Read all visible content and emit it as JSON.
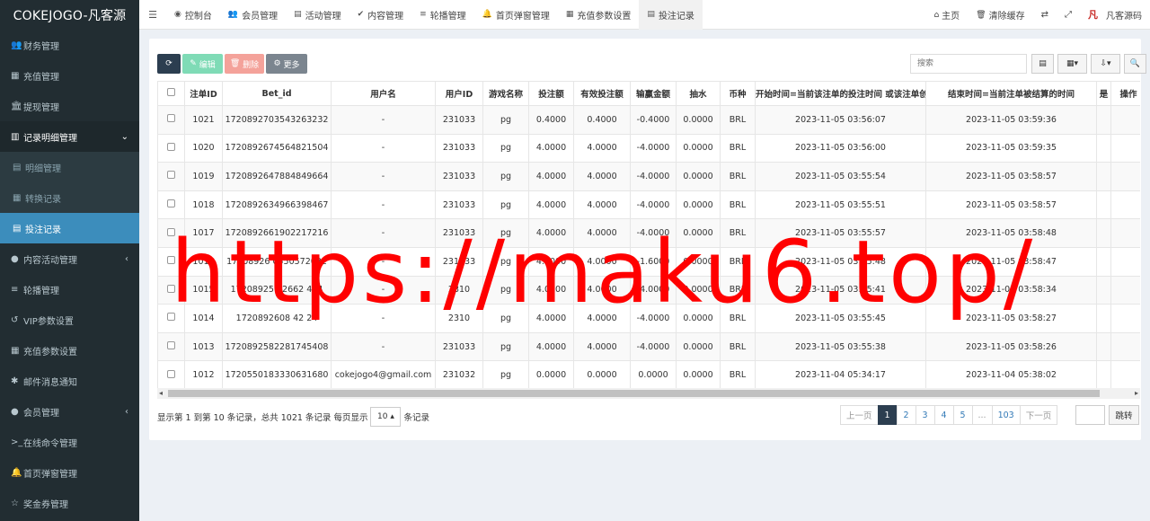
{
  "app": {
    "title": "COKEJOGO-凡客源"
  },
  "sidebar": {
    "items": [
      {
        "icon": "users-icon",
        "glyph": "👥",
        "label": "财务管理"
      },
      {
        "icon": "grid-icon",
        "glyph": "▦",
        "label": "充值管理"
      },
      {
        "icon": "bank-icon",
        "glyph": "🏛",
        "label": "提现管理"
      },
      {
        "icon": "bar-chart-icon",
        "glyph": "▥",
        "label": "记录明细管理"
      },
      {
        "icon": "calendar-icon",
        "glyph": "▤",
        "label": "明细管理"
      },
      {
        "icon": "grid-icon",
        "glyph": "▦",
        "label": "转换记录"
      },
      {
        "icon": "calendar-icon",
        "glyph": "▤",
        "label": "投注记录"
      },
      {
        "icon": "chat-icon",
        "glyph": "●",
        "label": "内容活动管理"
      },
      {
        "icon": "bars-icon",
        "glyph": "≡",
        "label": "轮播管理"
      },
      {
        "icon": "history-icon",
        "glyph": "↺",
        "label": "VIP参数设置"
      },
      {
        "icon": "grid-icon",
        "glyph": "▦",
        "label": "充值参数设置"
      },
      {
        "icon": "asterisk-icon",
        "glyph": "✱",
        "label": "邮件消息通知"
      },
      {
        "icon": "user-circle-icon",
        "glyph": "●",
        "label": "会员管理"
      },
      {
        "icon": "terminal-icon",
        "glyph": ">_",
        "label": "在线命令管理"
      },
      {
        "icon": "bell-icon",
        "glyph": "🔔",
        "label": "首页弹窗管理"
      },
      {
        "icon": "star-icon",
        "glyph": "☆",
        "label": "奖金券管理"
      }
    ]
  },
  "topnav": {
    "tabs": [
      {
        "icon": "dashboard-icon",
        "glyph": "◉",
        "label": "控制台"
      },
      {
        "icon": "users-icon",
        "glyph": "👥",
        "label": "会员管理"
      },
      {
        "icon": "calendar-icon",
        "glyph": "▤",
        "label": "活动管理"
      },
      {
        "icon": "check-circle-icon",
        "glyph": "✔",
        "label": "内容管理"
      },
      {
        "icon": "bars-icon",
        "glyph": "≡",
        "label": "轮播管理"
      },
      {
        "icon": "bell-icon",
        "glyph": "🔔",
        "label": "首页弹窗管理"
      },
      {
        "icon": "grid-icon",
        "glyph": "▦",
        "label": "充值参数设置"
      },
      {
        "icon": "calendar-icon",
        "glyph": "▤",
        "label": "投注记录"
      }
    ],
    "right": {
      "home": "主页",
      "clear_cache": "清除缓存",
      "brand": "凡客源码"
    }
  },
  "toolbar": {
    "edit_label": "编辑",
    "delete_label": "删除",
    "more_label": "更多",
    "search_placeholder": "搜索"
  },
  "table": {
    "columns": [
      "注单ID",
      "Bet_id",
      "用户名",
      "用户ID",
      "游戏名称",
      "投注额",
      "有效投注额",
      "输赢金额",
      "抽水",
      "币种",
      "开始时间=当前该注单的投注时间 或该注单创建时间",
      "结束时间=当前注单被结算的时间",
      "是",
      "操作"
    ],
    "rows": [
      [
        "1021",
        "1720892703543263232",
        "-",
        "231033",
        "pg",
        "0.4000",
        "0.4000",
        "-0.4000",
        "0.0000",
        "BRL",
        "2023-11-05 03:56:07",
        "2023-11-05 03:59:36"
      ],
      [
        "1020",
        "1720892674564821504",
        "-",
        "231033",
        "pg",
        "4.0000",
        "4.0000",
        "-4.0000",
        "0.0000",
        "BRL",
        "2023-11-05 03:56:00",
        "2023-11-05 03:59:35"
      ],
      [
        "1019",
        "1720892647884849664",
        "-",
        "231033",
        "pg",
        "4.0000",
        "4.0000",
        "-4.0000",
        "0.0000",
        "BRL",
        "2023-11-05 03:55:54",
        "2023-11-05 03:58:57"
      ],
      [
        "1018",
        "1720892634966398467",
        "-",
        "231033",
        "pg",
        "4.0000",
        "4.0000",
        "-4.0000",
        "0.0000",
        "BRL",
        "2023-11-05 03:55:51",
        "2023-11-05 03:58:57"
      ],
      [
        "1017",
        "1720892661902217216",
        "-",
        "231033",
        "pg",
        "4.0000",
        "4.0000",
        "-4.0000",
        "0.0000",
        "BRL",
        "2023-11-05 03:55:57",
        "2023-11-05 03:58:48"
      ],
      [
        "1016",
        "17208926  0550572032",
        "-",
        "231033",
        "pg",
        "4.0000",
        "4.0000",
        "-1.6000",
        "0.0000",
        "BRL",
        "2023-11-05 03:55:48",
        "2023-11-05 03:58:47"
      ],
      [
        "1015",
        "17208925  82662  464",
        "-",
        "2310  ",
        "pg",
        "4.0000",
        "4.0000",
        "-4.0000",
        "0.0000",
        "BRL",
        "2023-11-05 03:55:41",
        "2023-11-05 03:58:34"
      ],
      [
        "1014",
        "1720892608  42  24",
        "-",
        "2310  ",
        "pg",
        "4.0000",
        "4.0000",
        "-4.0000",
        "0.0000",
        "BRL",
        "2023-11-05 03:55:45",
        "2023-11-05 03:58:27"
      ],
      [
        "1013",
        "1720892582281745408",
        "-",
        "231033",
        "pg",
        "4.0000",
        "4.0000",
        "-4.0000",
        "0.0000",
        "BRL",
        "2023-11-05 03:55:38",
        "2023-11-05 03:58:26"
      ],
      [
        "1012",
        "1720550183330631680",
        "cokejogo4@gmail.com",
        "231032",
        "pg",
        "0.0000",
        "0.0000",
        "0.0000",
        "0.0000",
        "BRL",
        "2023-11-04 05:34:17",
        "2023-11-04 05:38:02"
      ]
    ]
  },
  "footer": {
    "info_prefix": "显示第 1 到第 10 条记录，总共 1021 条记录 每页显示",
    "page_size": "10",
    "info_suffix": "条记录"
  },
  "pagination": {
    "prev": "上一页",
    "pages": [
      "1",
      "2",
      "3",
      "4",
      "5",
      "...",
      "103"
    ],
    "next": "下一页",
    "jump": "跳转"
  },
  "watermark": "https://maku6.top/"
}
